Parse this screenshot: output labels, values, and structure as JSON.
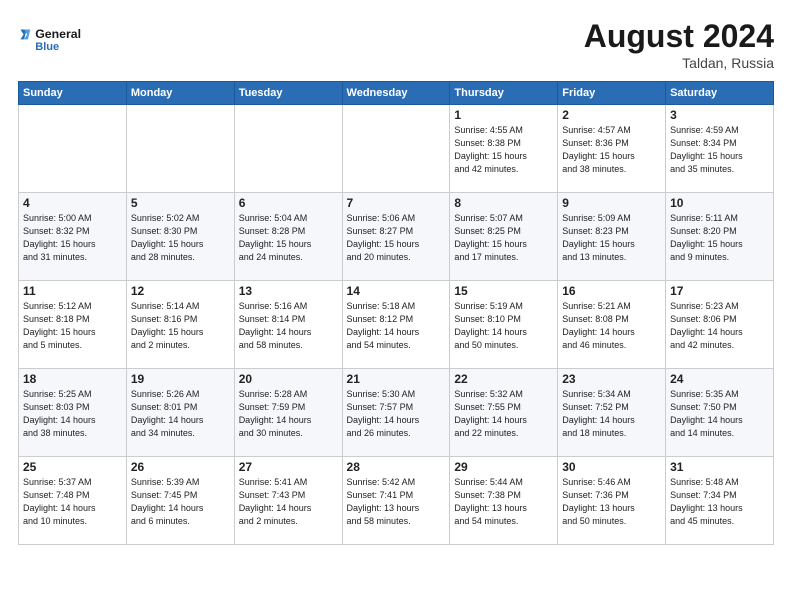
{
  "logo": {
    "line1": "General",
    "line2": "Blue"
  },
  "title": "August 2024",
  "subtitle": "Taldan, Russia",
  "days_header": [
    "Sunday",
    "Monday",
    "Tuesday",
    "Wednesday",
    "Thursday",
    "Friday",
    "Saturday"
  ],
  "weeks": [
    [
      {
        "num": "",
        "info": ""
      },
      {
        "num": "",
        "info": ""
      },
      {
        "num": "",
        "info": ""
      },
      {
        "num": "",
        "info": ""
      },
      {
        "num": "1",
        "info": "Sunrise: 4:55 AM\nSunset: 8:38 PM\nDaylight: 15 hours\nand 42 minutes."
      },
      {
        "num": "2",
        "info": "Sunrise: 4:57 AM\nSunset: 8:36 PM\nDaylight: 15 hours\nand 38 minutes."
      },
      {
        "num": "3",
        "info": "Sunrise: 4:59 AM\nSunset: 8:34 PM\nDaylight: 15 hours\nand 35 minutes."
      }
    ],
    [
      {
        "num": "4",
        "info": "Sunrise: 5:00 AM\nSunset: 8:32 PM\nDaylight: 15 hours\nand 31 minutes."
      },
      {
        "num": "5",
        "info": "Sunrise: 5:02 AM\nSunset: 8:30 PM\nDaylight: 15 hours\nand 28 minutes."
      },
      {
        "num": "6",
        "info": "Sunrise: 5:04 AM\nSunset: 8:28 PM\nDaylight: 15 hours\nand 24 minutes."
      },
      {
        "num": "7",
        "info": "Sunrise: 5:06 AM\nSunset: 8:27 PM\nDaylight: 15 hours\nand 20 minutes."
      },
      {
        "num": "8",
        "info": "Sunrise: 5:07 AM\nSunset: 8:25 PM\nDaylight: 15 hours\nand 17 minutes."
      },
      {
        "num": "9",
        "info": "Sunrise: 5:09 AM\nSunset: 8:23 PM\nDaylight: 15 hours\nand 13 minutes."
      },
      {
        "num": "10",
        "info": "Sunrise: 5:11 AM\nSunset: 8:20 PM\nDaylight: 15 hours\nand 9 minutes."
      }
    ],
    [
      {
        "num": "11",
        "info": "Sunrise: 5:12 AM\nSunset: 8:18 PM\nDaylight: 15 hours\nand 5 minutes."
      },
      {
        "num": "12",
        "info": "Sunrise: 5:14 AM\nSunset: 8:16 PM\nDaylight: 15 hours\nand 2 minutes."
      },
      {
        "num": "13",
        "info": "Sunrise: 5:16 AM\nSunset: 8:14 PM\nDaylight: 14 hours\nand 58 minutes."
      },
      {
        "num": "14",
        "info": "Sunrise: 5:18 AM\nSunset: 8:12 PM\nDaylight: 14 hours\nand 54 minutes."
      },
      {
        "num": "15",
        "info": "Sunrise: 5:19 AM\nSunset: 8:10 PM\nDaylight: 14 hours\nand 50 minutes."
      },
      {
        "num": "16",
        "info": "Sunrise: 5:21 AM\nSunset: 8:08 PM\nDaylight: 14 hours\nand 46 minutes."
      },
      {
        "num": "17",
        "info": "Sunrise: 5:23 AM\nSunset: 8:06 PM\nDaylight: 14 hours\nand 42 minutes."
      }
    ],
    [
      {
        "num": "18",
        "info": "Sunrise: 5:25 AM\nSunset: 8:03 PM\nDaylight: 14 hours\nand 38 minutes."
      },
      {
        "num": "19",
        "info": "Sunrise: 5:26 AM\nSunset: 8:01 PM\nDaylight: 14 hours\nand 34 minutes."
      },
      {
        "num": "20",
        "info": "Sunrise: 5:28 AM\nSunset: 7:59 PM\nDaylight: 14 hours\nand 30 minutes."
      },
      {
        "num": "21",
        "info": "Sunrise: 5:30 AM\nSunset: 7:57 PM\nDaylight: 14 hours\nand 26 minutes."
      },
      {
        "num": "22",
        "info": "Sunrise: 5:32 AM\nSunset: 7:55 PM\nDaylight: 14 hours\nand 22 minutes."
      },
      {
        "num": "23",
        "info": "Sunrise: 5:34 AM\nSunset: 7:52 PM\nDaylight: 14 hours\nand 18 minutes."
      },
      {
        "num": "24",
        "info": "Sunrise: 5:35 AM\nSunset: 7:50 PM\nDaylight: 14 hours\nand 14 minutes."
      }
    ],
    [
      {
        "num": "25",
        "info": "Sunrise: 5:37 AM\nSunset: 7:48 PM\nDaylight: 14 hours\nand 10 minutes."
      },
      {
        "num": "26",
        "info": "Sunrise: 5:39 AM\nSunset: 7:45 PM\nDaylight: 14 hours\nand 6 minutes."
      },
      {
        "num": "27",
        "info": "Sunrise: 5:41 AM\nSunset: 7:43 PM\nDaylight: 14 hours\nand 2 minutes."
      },
      {
        "num": "28",
        "info": "Sunrise: 5:42 AM\nSunset: 7:41 PM\nDaylight: 13 hours\nand 58 minutes."
      },
      {
        "num": "29",
        "info": "Sunrise: 5:44 AM\nSunset: 7:38 PM\nDaylight: 13 hours\nand 54 minutes."
      },
      {
        "num": "30",
        "info": "Sunrise: 5:46 AM\nSunset: 7:36 PM\nDaylight: 13 hours\nand 50 minutes."
      },
      {
        "num": "31",
        "info": "Sunrise: 5:48 AM\nSunset: 7:34 PM\nDaylight: 13 hours\nand 45 minutes."
      }
    ]
  ]
}
